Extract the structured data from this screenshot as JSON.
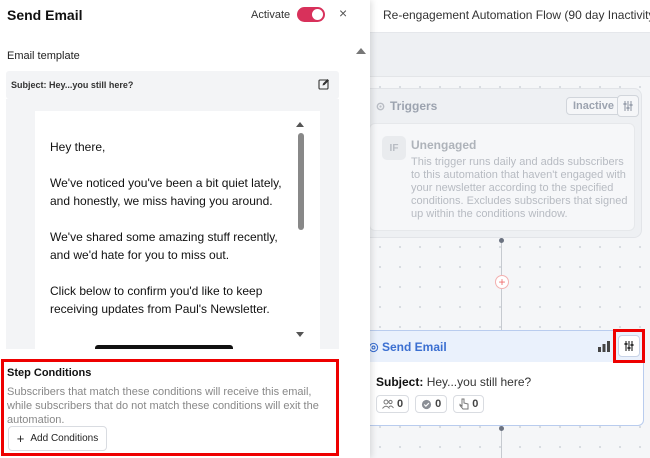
{
  "canvas": {
    "flow_title": "Re-engagement Automation Flow (90 day Inactivity)",
    "trigger_card": {
      "title": "Triggers",
      "status": "Inactive",
      "condition_badge": "IF",
      "condition_name": "Unengaged",
      "description": "This trigger runs daily and adds subscribers to this automation that haven't engaged with your newsletter according to the specified conditions. Excludes subscribers that signed up within the conditions window."
    },
    "email_card": {
      "title": "Send Email",
      "subject_label": "Subject:",
      "subject_value": "Hey...you still here?",
      "stats": [
        {
          "icon": "users-icon",
          "value": "0"
        },
        {
          "icon": "check-circle-icon",
          "value": "0"
        },
        {
          "icon": "pointer-icon",
          "value": "0"
        }
      ]
    }
  },
  "panel": {
    "title": "Send Email",
    "activate_label": "Activate",
    "activate_on": true,
    "close_glyph": "×",
    "template_section_label": "Email template",
    "subject_line": "Subject: Hey...you still here?",
    "email_body": [
      "Hey there,",
      "We've noticed you've been a bit quiet lately, and honestly, we miss having you around.",
      "We've shared some amazing stuff recently, and we'd hate for you to miss out.",
      "Click below to confirm you'd like to keep receiving updates from Paul's Newsletter."
    ],
    "step_conditions": {
      "title": "Step Conditions",
      "description": "Subscribers that match these conditions will receive this email, while subscribers that do not match these conditions will exit the automation.",
      "add_button_label": "Add Conditions",
      "add_button_glyph": "+"
    }
  },
  "colors": {
    "toggle_on": "#d8315b",
    "highlight": "#e00000",
    "email_card_accent": "#3b6fd1"
  }
}
